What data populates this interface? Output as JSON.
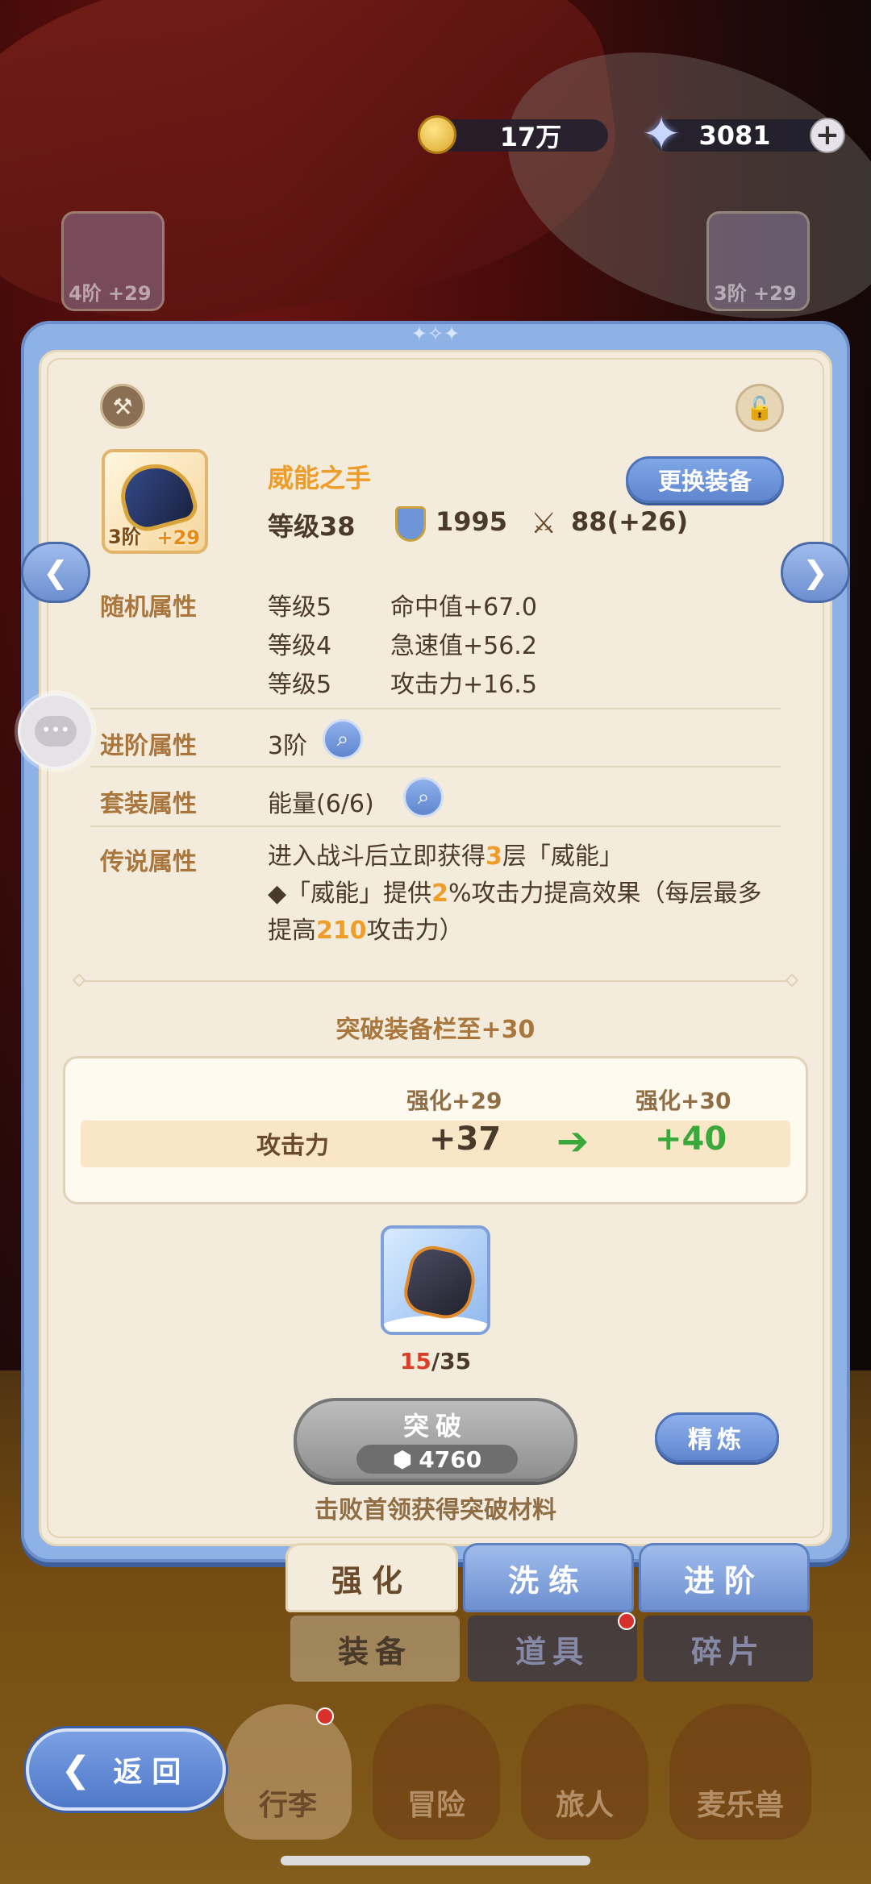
{
  "currency": {
    "gold": "17万",
    "gems": "3081",
    "plus": "+"
  },
  "bg_slots": {
    "left": "4阶 +29",
    "right": "3阶 +29"
  },
  "item": {
    "tier": "3阶",
    "enhance": "+29",
    "name": "威能之手",
    "swap_label": "更换装备",
    "level": "等级38",
    "defense": "1995",
    "attack": "88(+26)"
  },
  "random_attr": {
    "label": "随机属性",
    "rows": [
      {
        "level": "等级5",
        "stat": "命中值+67.0"
      },
      {
        "level": "等级4",
        "stat": "急速值+56.2"
      },
      {
        "level": "等级5",
        "stat": "攻击力+16.5"
      }
    ]
  },
  "advance_attr": {
    "label": "进阶属性",
    "value": "3阶"
  },
  "set_attr": {
    "label": "套装属性",
    "value": "能量(6/6)"
  },
  "legend_attr": {
    "label": "传说属性",
    "p1": "进入战斗后立即获得",
    "n1": "3",
    "p2": "层「威能」",
    "p3": "◆「威能」提供",
    "n2": "2",
    "p4": "%攻击力提高效果（每层最多提高",
    "n3": "210",
    "p5": "攻击力）"
  },
  "breakthrough": {
    "title": "突破装备栏至+30",
    "col_old": "强化+29",
    "col_new": "强化+30",
    "stat_label": "攻击力",
    "old_value": "+37",
    "new_value": "+40",
    "mat_have": "15",
    "mat_need": "/35",
    "button_label": "突破",
    "cost": "4760",
    "refine_label": "精炼",
    "hint": "击败首领获得突破材料"
  },
  "tabs": [
    "强化",
    "洗练",
    "进阶"
  ],
  "sub_tabs": [
    "装备",
    "道具",
    "碎片"
  ],
  "nav": [
    "行李",
    "冒险",
    "旅人",
    "麦乐兽"
  ],
  "back_label": "返回"
}
